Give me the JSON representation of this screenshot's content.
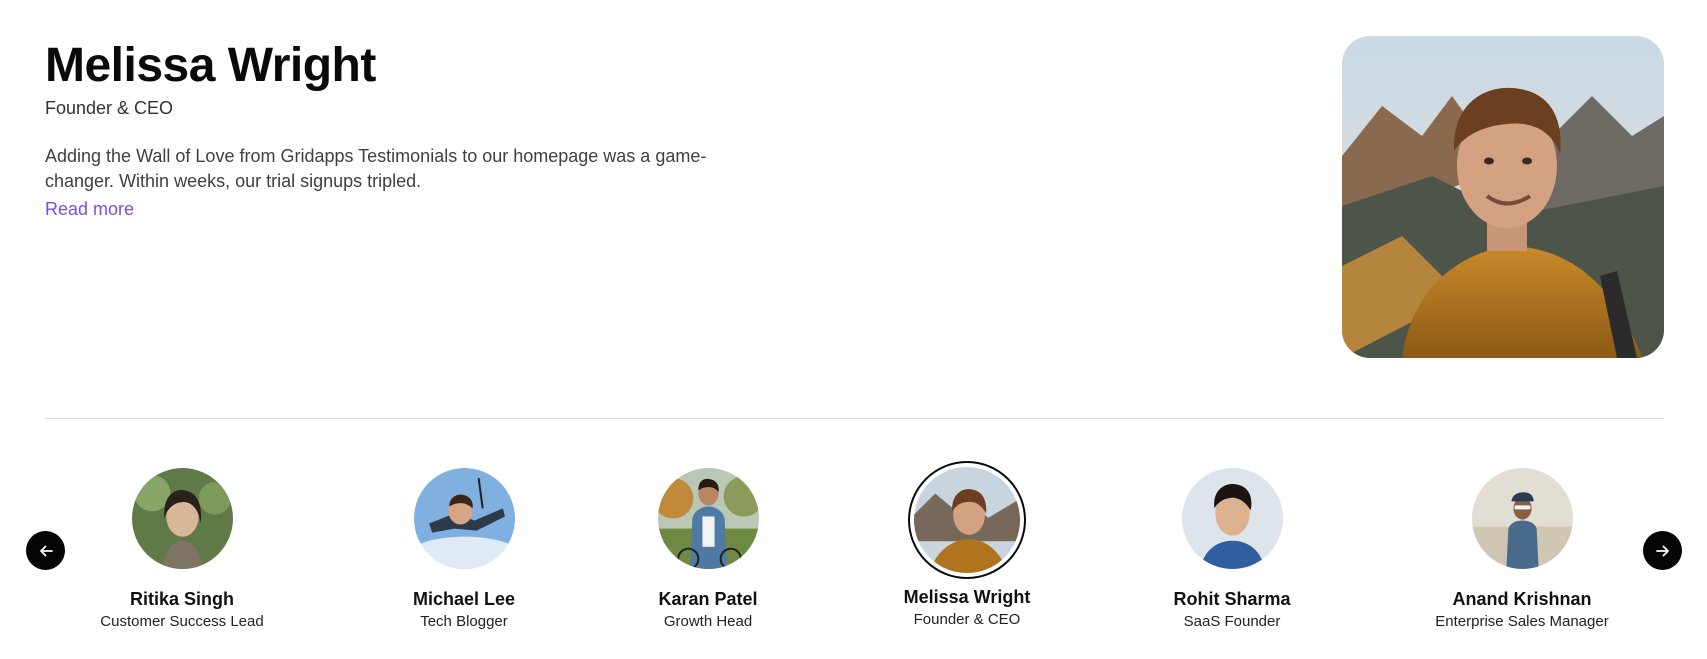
{
  "featured": {
    "name": "Melissa Wright",
    "role": "Founder & CEO",
    "quote": "Adding the Wall of Love from Gridapps Testimonials to our homepage was a game-changer. Within weeks, our trial signups tripled.",
    "read_more": "Read more"
  },
  "carousel": {
    "people": [
      {
        "name": "Ritika Singh",
        "role": "Customer Success Lead"
      },
      {
        "name": "Michael Lee",
        "role": "Tech Blogger"
      },
      {
        "name": "Karan Patel",
        "role": "Growth Head"
      },
      {
        "name": "Melissa Wright",
        "role": "Founder & CEO"
      },
      {
        "name": "Rohit Sharma",
        "role": "SaaS Founder"
      },
      {
        "name": "Anand Krishnan",
        "role": "Enterprise Sales Manager"
      }
    ],
    "active_index": 3
  },
  "icons": {
    "prev": "arrow-left-icon",
    "next": "arrow-right-icon"
  },
  "colors": {
    "accent": "#7c4ddb",
    "nav_button": "#050505",
    "divider": "#d6dde8"
  }
}
